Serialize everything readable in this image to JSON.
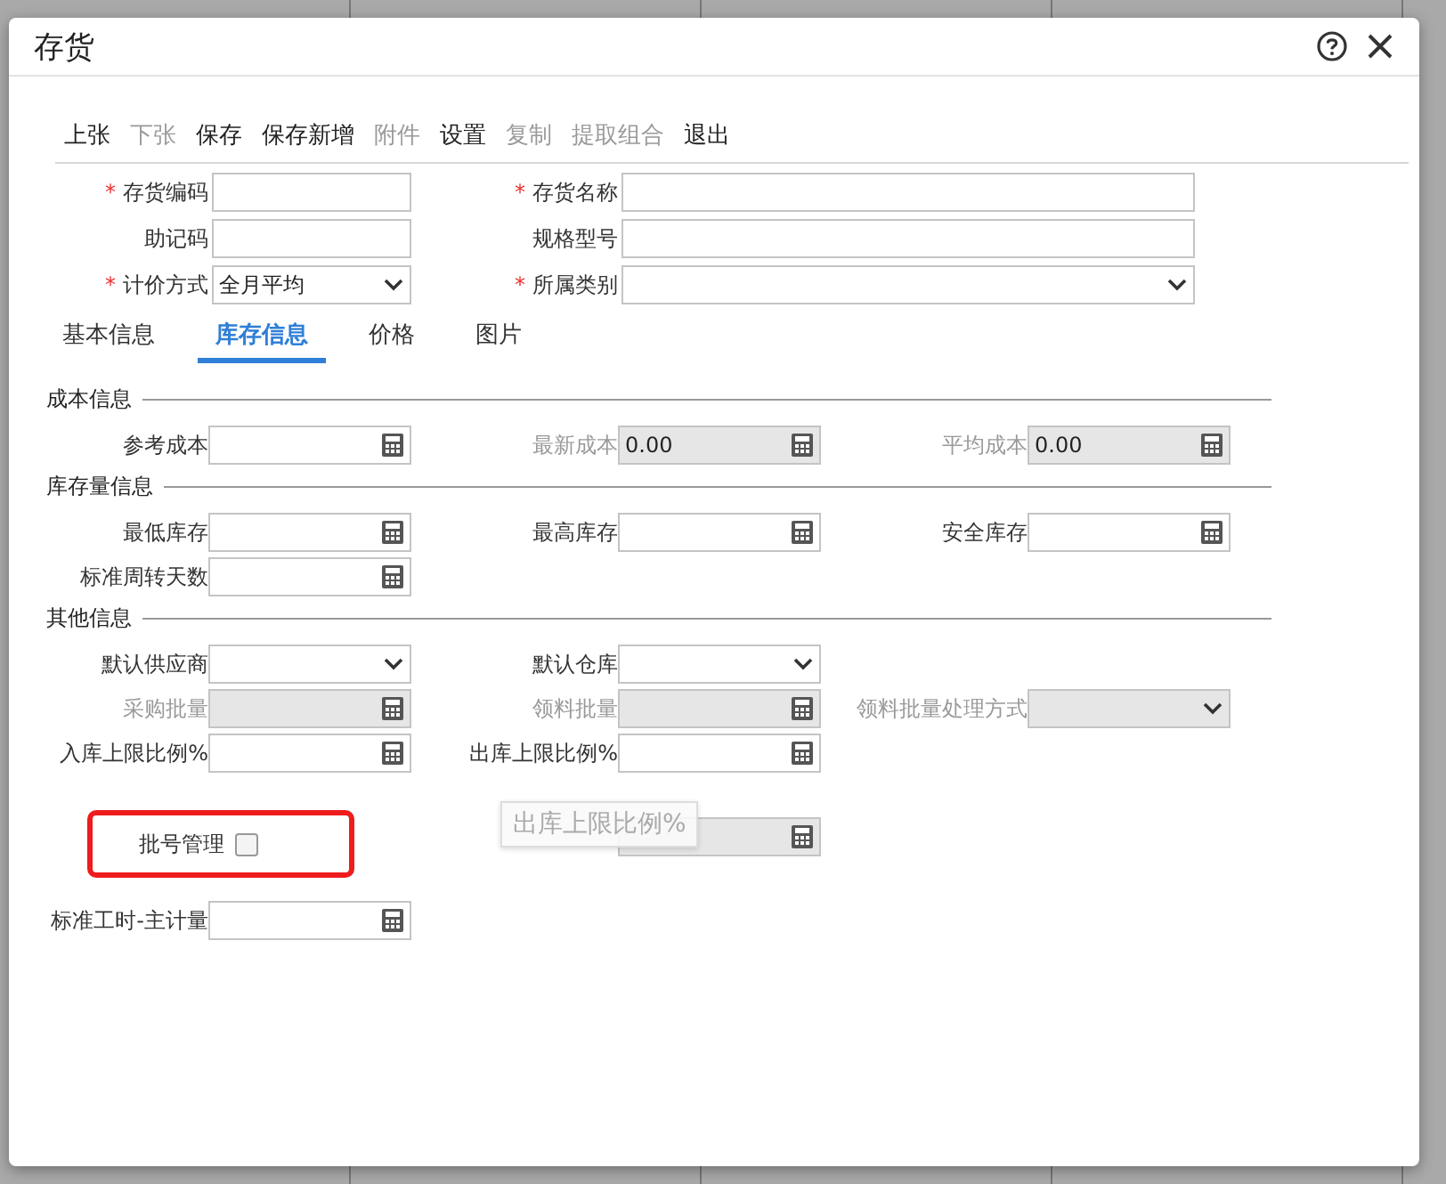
{
  "window": {
    "title": "存货"
  },
  "required_mark": "*",
  "toolbar": [
    {
      "label": "上张",
      "disabled": false
    },
    {
      "label": "下张",
      "disabled": true
    },
    {
      "label": "保存",
      "disabled": false
    },
    {
      "label": "保存新增",
      "disabled": false
    },
    {
      "label": "附件",
      "disabled": true
    },
    {
      "label": "设置",
      "disabled": false
    },
    {
      "label": "复制",
      "disabled": true
    },
    {
      "label": "提取组合",
      "disabled": true
    },
    {
      "label": "退出",
      "disabled": false
    }
  ],
  "header_fields": [
    {
      "label": "存货编码",
      "required": true,
      "kind": "text"
    },
    {
      "label": "存货名称",
      "required": true,
      "kind": "text"
    },
    {
      "label": "助记码",
      "required": false,
      "kind": "text"
    },
    {
      "label": "规格型号",
      "required": false,
      "kind": "text"
    },
    {
      "label": "计价方式",
      "required": true,
      "kind": "select",
      "value": "全月平均"
    },
    {
      "label": "所属类别",
      "required": true,
      "kind": "select"
    }
  ],
  "tabs": [
    {
      "label": "基本信息",
      "selected": false
    },
    {
      "label": "库存信息",
      "selected": true
    },
    {
      "label": "价格",
      "selected": false
    },
    {
      "label": "图片",
      "selected": false
    }
  ],
  "sections": [
    {
      "title": "成本信息",
      "rows": [
        [
          {
            "label": "参考成本",
            "kind": "calc",
            "disabled": false
          },
          {
            "label": "最新成本",
            "kind": "calc",
            "disabled": true,
            "value": "0.00"
          },
          {
            "label": "平均成本",
            "kind": "calc",
            "disabled": true,
            "value": "0.00"
          }
        ]
      ]
    },
    {
      "title": "库存量信息",
      "rows": [
        [
          {
            "label": "最低库存",
            "kind": "calc",
            "disabled": false
          },
          {
            "label": "最高库存",
            "kind": "calc",
            "disabled": false
          },
          {
            "label": "安全库存",
            "kind": "calc",
            "disabled": false
          }
        ],
        [
          {
            "label": "标准周转天数",
            "kind": "calc",
            "disabled": false
          }
        ]
      ]
    },
    {
      "title": "其他信息",
      "rows": [
        [
          {
            "label": "默认供应商",
            "kind": "select",
            "disabled": false
          },
          {
            "label": "默认仓库",
            "kind": "select",
            "disabled": false
          }
        ],
        [
          {
            "label": "采购批量",
            "kind": "calc",
            "disabled": true
          },
          {
            "label": "领料批量",
            "kind": "calc",
            "disabled": true
          },
          {
            "label": "领料批量处理方式",
            "kind": "select",
            "disabled": true
          }
        ],
        [
          {
            "label": "入库上限比例%",
            "kind": "calc",
            "disabled": false
          },
          {
            "label": "出库上限比例%",
            "kind": "calc",
            "disabled": false
          }
        ],
        [
          {
            "label": "批号管理",
            "kind": "checkbox",
            "checked": false,
            "highlighted": true
          },
          {
            "kind": "calc",
            "disabled": true
          }
        ],
        [
          {
            "label": "标准工时-主计量",
            "kind": "calc",
            "disabled": false
          }
        ]
      ]
    }
  ],
  "tooltip": {
    "text": "出库上限比例%"
  }
}
